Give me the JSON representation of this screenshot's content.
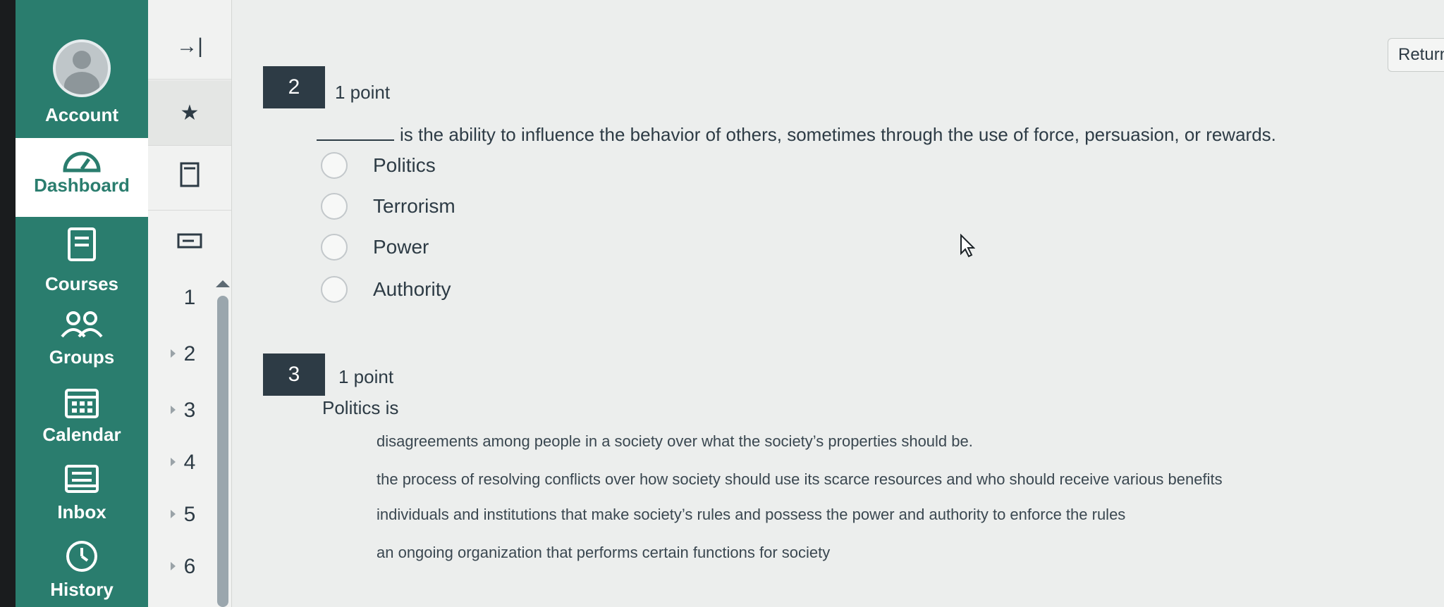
{
  "global_nav": {
    "account": "Account",
    "dashboard": "Dashboard",
    "courses": "Courses",
    "groups": "Groups",
    "calendar": "Calendar",
    "inbox": "Inbox",
    "history": "History"
  },
  "course_nav": {
    "question_numbers": [
      "1",
      "2",
      "3",
      "4",
      "5",
      "6"
    ]
  },
  "header": {
    "return_label": "Return"
  },
  "questions": [
    {
      "number": "2",
      "points": "1 point",
      "text": "is the ability to influence the behavior of others, sometimes through the use of force, persuasion, or rewards.",
      "options": [
        "Politics",
        "Terrorism",
        "Power",
        "Authority"
      ]
    },
    {
      "number": "3",
      "points": "1 point",
      "text": "Politics is",
      "options": [
        "disagreements among people in a society over what the society’s properties should be.",
        "the process of resolving conflicts over how society should use its scarce resources and who should receive various benefits",
        "individuals and institutions that make society’s rules and possess the power and authority to enforce the rules",
        "an ongoing organization that performs certain functions for society"
      ]
    }
  ],
  "colors": {
    "nav_green": "#2a7d6e",
    "badge_dark": "#2d3b45"
  }
}
